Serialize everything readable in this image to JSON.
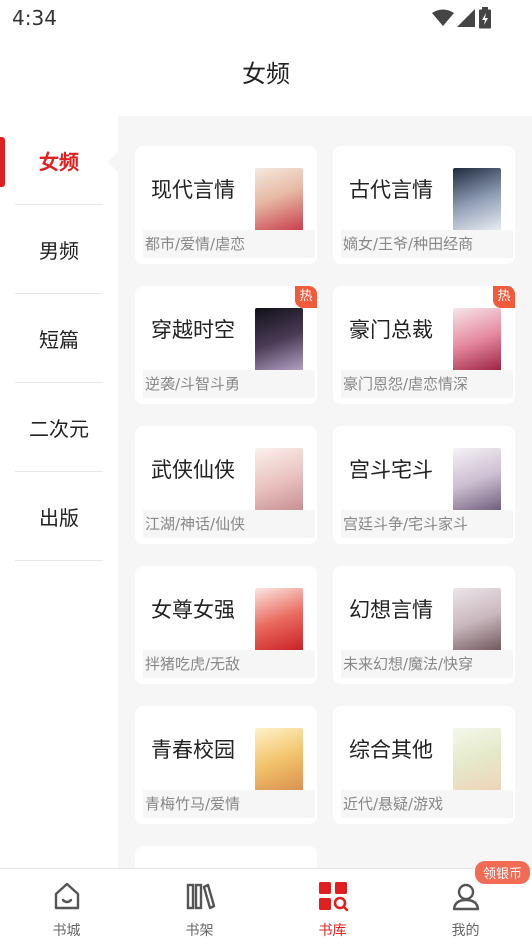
{
  "status_bar": {
    "time": "4:34"
  },
  "header": {
    "title": "女频"
  },
  "sidebar": {
    "items": [
      {
        "label": "女频",
        "active": true
      },
      {
        "label": "男频",
        "active": false
      },
      {
        "label": "短篇",
        "active": false
      },
      {
        "label": "二次元",
        "active": false
      },
      {
        "label": "出版",
        "active": false
      }
    ]
  },
  "categories": [
    {
      "title": "现代言情",
      "tags": "都市/爱情/虐恋",
      "hot": false
    },
    {
      "title": "古代言情",
      "tags": "嫡女/王爷/种田经商",
      "hot": false
    },
    {
      "title": "穿越时空",
      "tags": "逆袭/斗智斗勇",
      "hot": true
    },
    {
      "title": "豪门总裁",
      "tags": "豪门恩怨/虐恋情深",
      "hot": true
    },
    {
      "title": "武侠仙侠",
      "tags": "江湖/神话/仙侠",
      "hot": false
    },
    {
      "title": "宫斗宅斗",
      "tags": "宫廷斗争/宅斗家斗",
      "hot": false
    },
    {
      "title": "女尊女强",
      "tags": "拌猪吃虎/无敌",
      "hot": false
    },
    {
      "title": "幻想言情",
      "tags": "未来幻想/魔法/快穿",
      "hot": false
    },
    {
      "title": "青春校园",
      "tags": "青梅竹马/爱情",
      "hot": false
    },
    {
      "title": "综合其他",
      "tags": "近代/悬疑/游戏",
      "hot": false
    }
  ],
  "hot_badge_label": "热",
  "bottom_nav": {
    "tabs": [
      {
        "label": "书城",
        "icon": "home-icon",
        "active": false
      },
      {
        "label": "书架",
        "icon": "bookshelf-icon",
        "active": false
      },
      {
        "label": "书库",
        "icon": "library-icon",
        "active": true
      },
      {
        "label": "我的",
        "icon": "profile-icon",
        "active": false
      }
    ],
    "reward_badge": "领银币"
  },
  "colors": {
    "accent": "#e02020",
    "hot": "#f15a3a",
    "content_bg": "#f6f6f6"
  }
}
